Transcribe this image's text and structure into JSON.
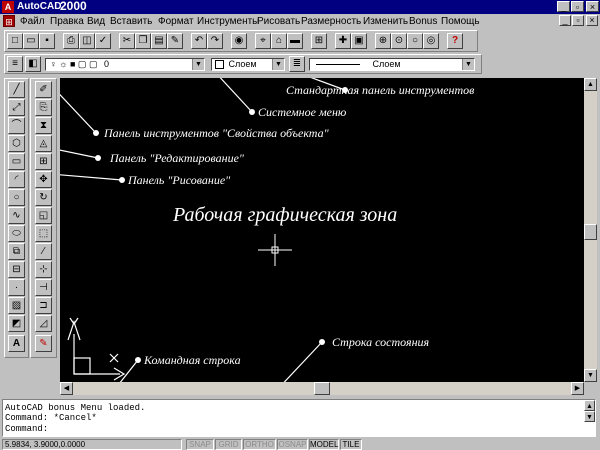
{
  "window": {
    "title": "AutoCAD",
    "version": "2000",
    "app_icon_glyph": "A"
  },
  "menu": [
    "Файл",
    "Правка",
    "Вид",
    "Вставить",
    "Формат",
    "Инструменты",
    "Рисовать",
    "Размерность",
    "Изменить",
    "Bonus",
    "Помощь"
  ],
  "layer_combo": {
    "value": "0"
  },
  "color_combo": {
    "value": "Слоем"
  },
  "linetype_combo": {
    "value": "Слоем"
  },
  "drawing_title": "Рабочая графическая зона",
  "annotations": {
    "standard_toolbar": "Стандартная панель инструментов",
    "system_menu": "Системное меню",
    "properties_toolbar": "Панель инструментов \"Свойства объекта\"",
    "modify_panel": "Панель \"Редактирование\"",
    "draw_panel": "Панель \"Рисование\"",
    "status_line": "Строка состояния",
    "command_line": "Командная строка"
  },
  "command_lines": [
    "AutoCAD bonus Menu loaded.",
    "Command: *Cancel*",
    "Command:"
  ],
  "status": {
    "coordinates": "5.9834, 3.9000,0.0000",
    "modes": [
      {
        "label": "SNAP",
        "active": false
      },
      {
        "label": "GRID",
        "active": false
      },
      {
        "label": "ORTHO",
        "active": false
      },
      {
        "label": "OSNAP",
        "active": false
      },
      {
        "label": "MODEL",
        "active": true
      },
      {
        "label": "TILE",
        "active": true
      }
    ]
  },
  "colors": {
    "drawing_bg": "#000000",
    "title_bar": "#000080",
    "ui_face": "#c0c0c0",
    "annotation_text": "#ffffff"
  }
}
